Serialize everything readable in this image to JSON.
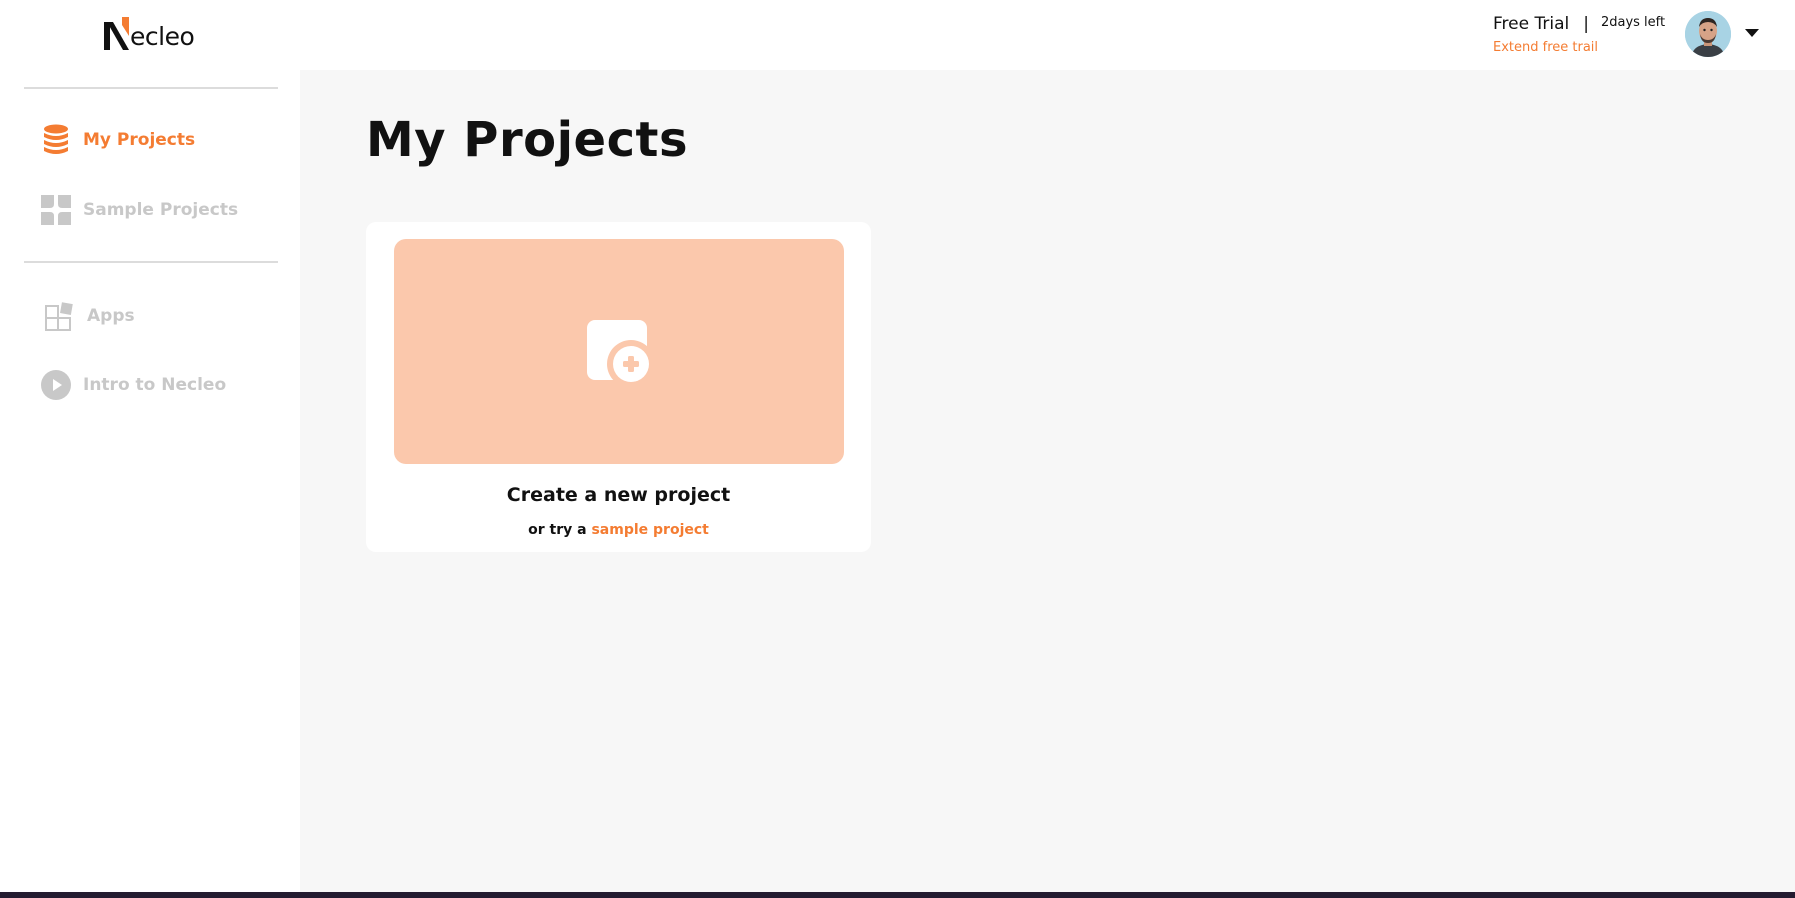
{
  "brand": {
    "logo_text": "ecleo",
    "accent_color": "#f47c32"
  },
  "header": {
    "trial_title": "Free Trial",
    "trial_separator": "|",
    "days_left": "2days left",
    "extend_link": "Extend free trail",
    "icons": {
      "avatar": "user-avatar",
      "menu": "caret-down-icon"
    }
  },
  "sidebar": {
    "items": [
      {
        "label": "My Projects",
        "icon": "database-icon",
        "active": true
      },
      {
        "label": "Sample Projects",
        "icon": "grid-leaf-icon",
        "active": false
      },
      {
        "label": "Apps",
        "icon": "apps-icon",
        "active": false
      },
      {
        "label": "Intro to Necleo",
        "icon": "play-icon",
        "active": false
      }
    ]
  },
  "main": {
    "page_title": "My Projects",
    "new_project_card": {
      "title": "Create a new project",
      "subtitle_prefix": "or try a ",
      "subtitle_link": "sample project",
      "icon": "add-file-icon",
      "tile_color": "#fbc8ac"
    }
  }
}
